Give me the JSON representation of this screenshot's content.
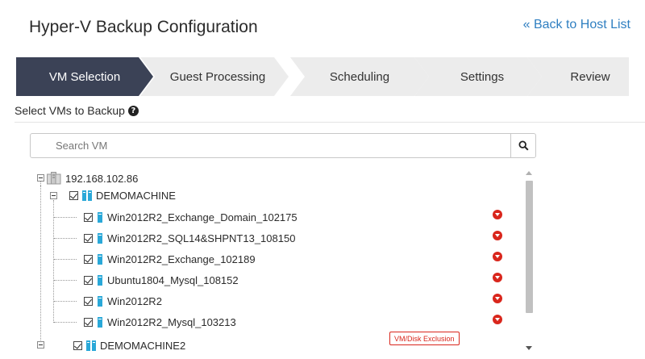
{
  "header": {
    "title": "Hyper-V Backup Configuration",
    "back_link": "« Back to Host List"
  },
  "wizard": {
    "steps": [
      {
        "label": "VM Selection",
        "active": true
      },
      {
        "label": "Guest Processing",
        "active": false
      },
      {
        "label": "Scheduling",
        "active": false
      },
      {
        "label": "Settings",
        "active": false
      },
      {
        "label": "Review",
        "active": false
      }
    ]
  },
  "section": {
    "label": "Select VMs to Backup",
    "help_icon": "question-circle-icon"
  },
  "search": {
    "placeholder": "Search VM",
    "value": "",
    "button_icon": "search-icon"
  },
  "tree": {
    "host": "192.168.102.86",
    "groups": [
      {
        "name": "DEMOMACHINE",
        "checked": true,
        "vms": [
          {
            "name": "Win2012R2_Exchange_Domain_102175",
            "checked": true
          },
          {
            "name": "Win2012R2_SQL14&SHPNT13_108150",
            "checked": true
          },
          {
            "name": "Win2012R2_Exchange_102189",
            "checked": true
          },
          {
            "name": "Ubuntu1804_Mysql_108152",
            "checked": true
          },
          {
            "name": "Win2012R2",
            "checked": true
          },
          {
            "name": "Win2012R2_Mysql_103213",
            "checked": true
          }
        ]
      },
      {
        "name": "DEMOMACHINE2",
        "checked": true,
        "vms": []
      }
    ],
    "exclusion_label": "VM/Disk Exclusion"
  },
  "colors": {
    "active_step": "#3b4256",
    "inactive_step": "#ececec",
    "link": "#2f7fc1",
    "flag": "#d9261c",
    "vm_icon": "#2aa8d8"
  }
}
